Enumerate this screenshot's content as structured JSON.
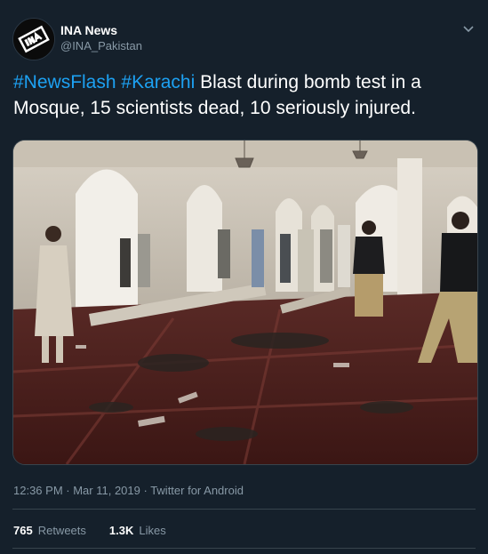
{
  "author": {
    "name": "INA News",
    "handle": "@INA_Pakistan",
    "avatar_text": "INA"
  },
  "tweet": {
    "hashtags": [
      "#NewsFlash",
      "#Karachi"
    ],
    "body": "Blast during bomb test in a Mosque, 15 scientists dead, 10 seriously injured."
  },
  "meta": {
    "time": "12:36 PM",
    "sep": " · ",
    "date": "Mar 11, 2019",
    "source": "Twitter for Android"
  },
  "stats": {
    "retweets_count": "765",
    "retweets_label": "Retweets",
    "likes_count": "1.3K",
    "likes_label": "Likes"
  },
  "colors": {
    "background": "#15202b",
    "link": "#1da1f2",
    "muted": "#8899a6",
    "border": "#38444d"
  }
}
